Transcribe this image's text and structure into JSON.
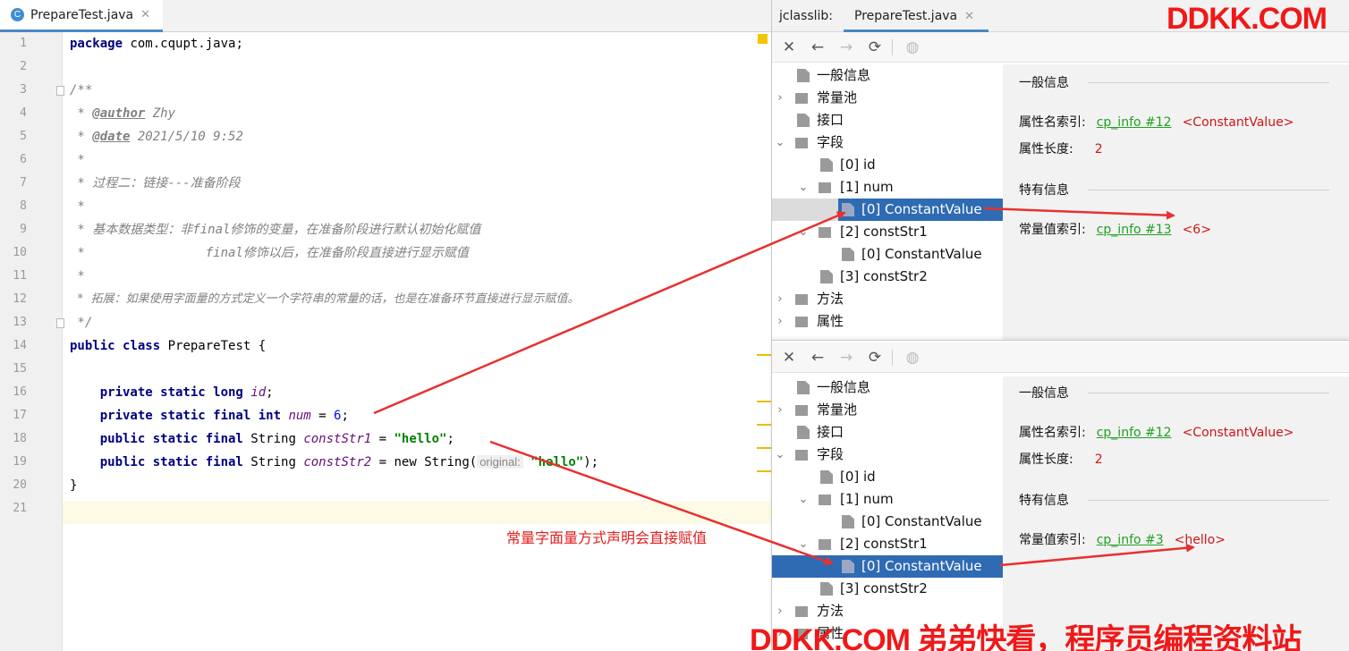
{
  "editor": {
    "tab_title": "PrepareTest.java",
    "tab_icon": "C",
    "line_numbers": [
      "1",
      "2",
      "3",
      "4",
      "5",
      "6",
      "7",
      "8",
      "9",
      "10",
      "11",
      "12",
      "13",
      "14",
      "15",
      "16",
      "17",
      "18",
      "19",
      "20",
      "21"
    ],
    "lines": {
      "l1_kw": "package",
      "l1_rest": " com.cqupt.java;",
      "l3": "/**",
      "l4_pre": " * ",
      "l4_tag": "@author",
      "l4_rest": " Zhy",
      "l5_pre": " * ",
      "l5_tag": "@date",
      "l5_rest": " 2021/5/10 9:52",
      "l6": " *",
      "l7": " * 过程二：链接---准备阶段",
      "l8": " *",
      "l9": " * 基本数据类型：非final修饰的变量，在准备阶段进行默认初始化赋值",
      "l10": " *                final修饰以后，在准备阶段直接进行显示赋值",
      "l11": " *",
      "l12": " * 拓展：如果使用字面量的方式定义一个字符串的常量的话，也是在准备环节直接进行显示赋值。",
      "l13": " */",
      "l14_kw": "public class",
      "l14_rest": " PrepareTest {",
      "l16_kw": "    private static long",
      "l16_fld": "id",
      "l16_end": ";",
      "l17_kw": "    private static final int",
      "l17_fld": "num",
      "l17_eq": " = ",
      "l17_num": "6",
      "l17_end": ";",
      "l18_kw": "    public static final",
      "l18_type": " String ",
      "l18_fld": "constStr1",
      "l18_eq": " = ",
      "l18_str": "\"hello\"",
      "l18_end": ";",
      "l19_kw": "    public static final",
      "l19_type": " String ",
      "l19_fld": "constStr2",
      "l19_eq": " = ",
      "l19_new": "new",
      "l19_type2": " String(",
      "l19_hint": "original:",
      "l19_str": "\"hello\"",
      "l19_end": ");",
      "l20": "}"
    },
    "annotation": "常量字面量方式声明会直接赋值"
  },
  "jclasslib": {
    "label": "jclasslib:",
    "tab_title": "PrepareTest.java",
    "top": {
      "tree": [
        "一般信息",
        "常量池",
        "接口",
        "字段",
        "[0] id",
        "[1] num",
        "[0] ConstantValue",
        "[2] constStr1",
        "[0] ConstantValue",
        "[3] constStr2",
        "方法",
        "属性"
      ],
      "detail": {
        "general_section": "一般信息",
        "attr_name_label": "属性名索引:",
        "attr_name_link": "cp_info #12",
        "attr_name_value": "<ConstantValue>",
        "attr_len_label": "属性长度:",
        "attr_len_value": "2",
        "specific_section": "特有信息",
        "const_label": "常量值索引:",
        "const_link": "cp_info #13",
        "const_value": "<6>"
      }
    },
    "bottom": {
      "tree": [
        "一般信息",
        "常量池",
        "接口",
        "字段",
        "[0] id",
        "[1] num",
        "[0] ConstantValue",
        "[2] constStr1",
        "[0] ConstantValue",
        "[3] constStr2",
        "方法",
        "属性"
      ],
      "detail": {
        "general_section": "一般信息",
        "attr_name_label": "属性名索引:",
        "attr_name_link": "cp_info #12",
        "attr_name_value": "<ConstantValue>",
        "attr_len_label": "属性长度:",
        "attr_len_value": "2",
        "specific_section": "特有信息",
        "const_label": "常量值索引:",
        "const_link": "cp_info #3",
        "const_value": "<hello>"
      }
    }
  },
  "watermark": {
    "top": "DDKK.COM",
    "bottom": "DDKK.COM 弟弟快看，程序员编程资料站"
  },
  "colors": {
    "accent": "#4a88c7",
    "selection": "#2f6bb3",
    "annotation_red": "#e01f1f",
    "link_green": "#22a022"
  }
}
